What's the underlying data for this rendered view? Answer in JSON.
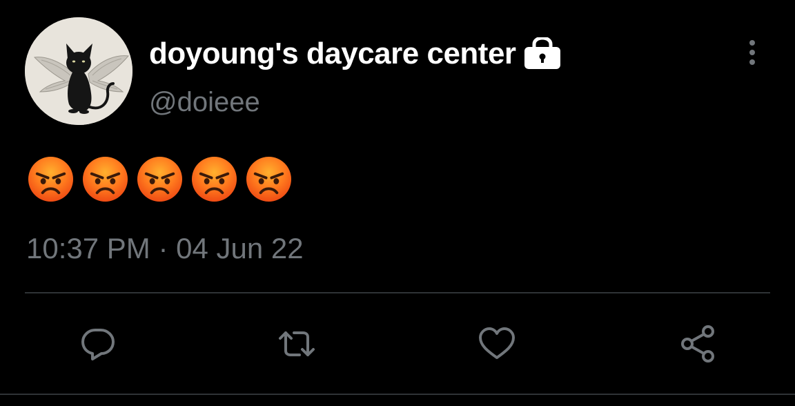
{
  "user": {
    "display_name": "doyoung's daycare center",
    "handle": "@doieee",
    "protected_icon": "lock-icon",
    "avatar": "black-cat-with-wings-avatar"
  },
  "tweet": {
    "emojis": [
      "😡",
      "😡",
      "😡",
      "😡",
      "😡"
    ],
    "timestamp": "10:37 PM · 04 Jun 22"
  },
  "actions": [
    {
      "name": "reply",
      "icon": "reply-icon"
    },
    {
      "name": "retweet",
      "icon": "retweet-icon"
    },
    {
      "name": "like",
      "icon": "heart-icon"
    },
    {
      "name": "share",
      "icon": "share-icon"
    }
  ],
  "colors": {
    "background": "#000000",
    "primary_text": "#ffffff",
    "secondary_text": "#71767b",
    "divider": "#2f3336",
    "icon": "#71767b"
  }
}
